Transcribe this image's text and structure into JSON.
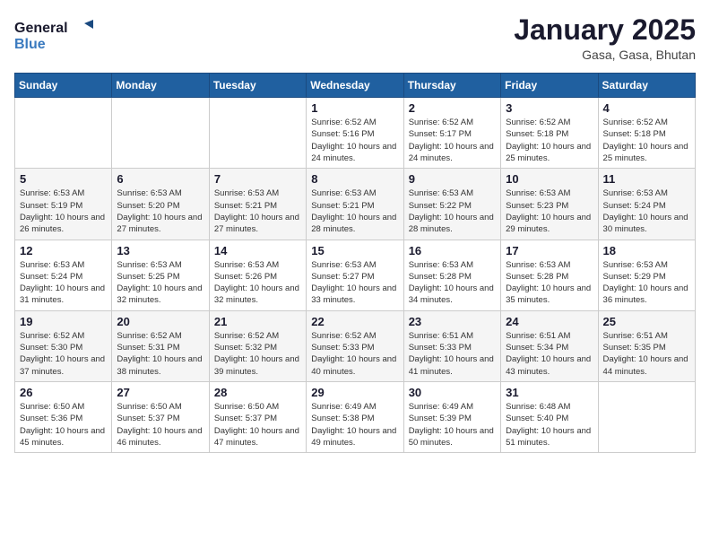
{
  "logo": {
    "line1": "General",
    "line2": "Blue"
  },
  "title": "January 2025",
  "subtitle": "Gasa, Gasa, Bhutan",
  "weekdays": [
    "Sunday",
    "Monday",
    "Tuesday",
    "Wednesday",
    "Thursday",
    "Friday",
    "Saturday"
  ],
  "weeks": [
    [
      {
        "day": "",
        "sunrise": "",
        "sunset": "",
        "daylight": ""
      },
      {
        "day": "",
        "sunrise": "",
        "sunset": "",
        "daylight": ""
      },
      {
        "day": "",
        "sunrise": "",
        "sunset": "",
        "daylight": ""
      },
      {
        "day": "1",
        "sunrise": "Sunrise: 6:52 AM",
        "sunset": "Sunset: 5:16 PM",
        "daylight": "Daylight: 10 hours and 24 minutes."
      },
      {
        "day": "2",
        "sunrise": "Sunrise: 6:52 AM",
        "sunset": "Sunset: 5:17 PM",
        "daylight": "Daylight: 10 hours and 24 minutes."
      },
      {
        "day": "3",
        "sunrise": "Sunrise: 6:52 AM",
        "sunset": "Sunset: 5:18 PM",
        "daylight": "Daylight: 10 hours and 25 minutes."
      },
      {
        "day": "4",
        "sunrise": "Sunrise: 6:52 AM",
        "sunset": "Sunset: 5:18 PM",
        "daylight": "Daylight: 10 hours and 25 minutes."
      }
    ],
    [
      {
        "day": "5",
        "sunrise": "Sunrise: 6:53 AM",
        "sunset": "Sunset: 5:19 PM",
        "daylight": "Daylight: 10 hours and 26 minutes."
      },
      {
        "day": "6",
        "sunrise": "Sunrise: 6:53 AM",
        "sunset": "Sunset: 5:20 PM",
        "daylight": "Daylight: 10 hours and 27 minutes."
      },
      {
        "day": "7",
        "sunrise": "Sunrise: 6:53 AM",
        "sunset": "Sunset: 5:21 PM",
        "daylight": "Daylight: 10 hours and 27 minutes."
      },
      {
        "day": "8",
        "sunrise": "Sunrise: 6:53 AM",
        "sunset": "Sunset: 5:21 PM",
        "daylight": "Daylight: 10 hours and 28 minutes."
      },
      {
        "day": "9",
        "sunrise": "Sunrise: 6:53 AM",
        "sunset": "Sunset: 5:22 PM",
        "daylight": "Daylight: 10 hours and 28 minutes."
      },
      {
        "day": "10",
        "sunrise": "Sunrise: 6:53 AM",
        "sunset": "Sunset: 5:23 PM",
        "daylight": "Daylight: 10 hours and 29 minutes."
      },
      {
        "day": "11",
        "sunrise": "Sunrise: 6:53 AM",
        "sunset": "Sunset: 5:24 PM",
        "daylight": "Daylight: 10 hours and 30 minutes."
      }
    ],
    [
      {
        "day": "12",
        "sunrise": "Sunrise: 6:53 AM",
        "sunset": "Sunset: 5:24 PM",
        "daylight": "Daylight: 10 hours and 31 minutes."
      },
      {
        "day": "13",
        "sunrise": "Sunrise: 6:53 AM",
        "sunset": "Sunset: 5:25 PM",
        "daylight": "Daylight: 10 hours and 32 minutes."
      },
      {
        "day": "14",
        "sunrise": "Sunrise: 6:53 AM",
        "sunset": "Sunset: 5:26 PM",
        "daylight": "Daylight: 10 hours and 32 minutes."
      },
      {
        "day": "15",
        "sunrise": "Sunrise: 6:53 AM",
        "sunset": "Sunset: 5:27 PM",
        "daylight": "Daylight: 10 hours and 33 minutes."
      },
      {
        "day": "16",
        "sunrise": "Sunrise: 6:53 AM",
        "sunset": "Sunset: 5:28 PM",
        "daylight": "Daylight: 10 hours and 34 minutes."
      },
      {
        "day": "17",
        "sunrise": "Sunrise: 6:53 AM",
        "sunset": "Sunset: 5:28 PM",
        "daylight": "Daylight: 10 hours and 35 minutes."
      },
      {
        "day": "18",
        "sunrise": "Sunrise: 6:53 AM",
        "sunset": "Sunset: 5:29 PM",
        "daylight": "Daylight: 10 hours and 36 minutes."
      }
    ],
    [
      {
        "day": "19",
        "sunrise": "Sunrise: 6:52 AM",
        "sunset": "Sunset: 5:30 PM",
        "daylight": "Daylight: 10 hours and 37 minutes."
      },
      {
        "day": "20",
        "sunrise": "Sunrise: 6:52 AM",
        "sunset": "Sunset: 5:31 PM",
        "daylight": "Daylight: 10 hours and 38 minutes."
      },
      {
        "day": "21",
        "sunrise": "Sunrise: 6:52 AM",
        "sunset": "Sunset: 5:32 PM",
        "daylight": "Daylight: 10 hours and 39 minutes."
      },
      {
        "day": "22",
        "sunrise": "Sunrise: 6:52 AM",
        "sunset": "Sunset: 5:33 PM",
        "daylight": "Daylight: 10 hours and 40 minutes."
      },
      {
        "day": "23",
        "sunrise": "Sunrise: 6:51 AM",
        "sunset": "Sunset: 5:33 PM",
        "daylight": "Daylight: 10 hours and 41 minutes."
      },
      {
        "day": "24",
        "sunrise": "Sunrise: 6:51 AM",
        "sunset": "Sunset: 5:34 PM",
        "daylight": "Daylight: 10 hours and 43 minutes."
      },
      {
        "day": "25",
        "sunrise": "Sunrise: 6:51 AM",
        "sunset": "Sunset: 5:35 PM",
        "daylight": "Daylight: 10 hours and 44 minutes."
      }
    ],
    [
      {
        "day": "26",
        "sunrise": "Sunrise: 6:50 AM",
        "sunset": "Sunset: 5:36 PM",
        "daylight": "Daylight: 10 hours and 45 minutes."
      },
      {
        "day": "27",
        "sunrise": "Sunrise: 6:50 AM",
        "sunset": "Sunset: 5:37 PM",
        "daylight": "Daylight: 10 hours and 46 minutes."
      },
      {
        "day": "28",
        "sunrise": "Sunrise: 6:50 AM",
        "sunset": "Sunset: 5:37 PM",
        "daylight": "Daylight: 10 hours and 47 minutes."
      },
      {
        "day": "29",
        "sunrise": "Sunrise: 6:49 AM",
        "sunset": "Sunset: 5:38 PM",
        "daylight": "Daylight: 10 hours and 49 minutes."
      },
      {
        "day": "30",
        "sunrise": "Sunrise: 6:49 AM",
        "sunset": "Sunset: 5:39 PM",
        "daylight": "Daylight: 10 hours and 50 minutes."
      },
      {
        "day": "31",
        "sunrise": "Sunrise: 6:48 AM",
        "sunset": "Sunset: 5:40 PM",
        "daylight": "Daylight: 10 hours and 51 minutes."
      },
      {
        "day": "",
        "sunrise": "",
        "sunset": "",
        "daylight": ""
      }
    ]
  ]
}
